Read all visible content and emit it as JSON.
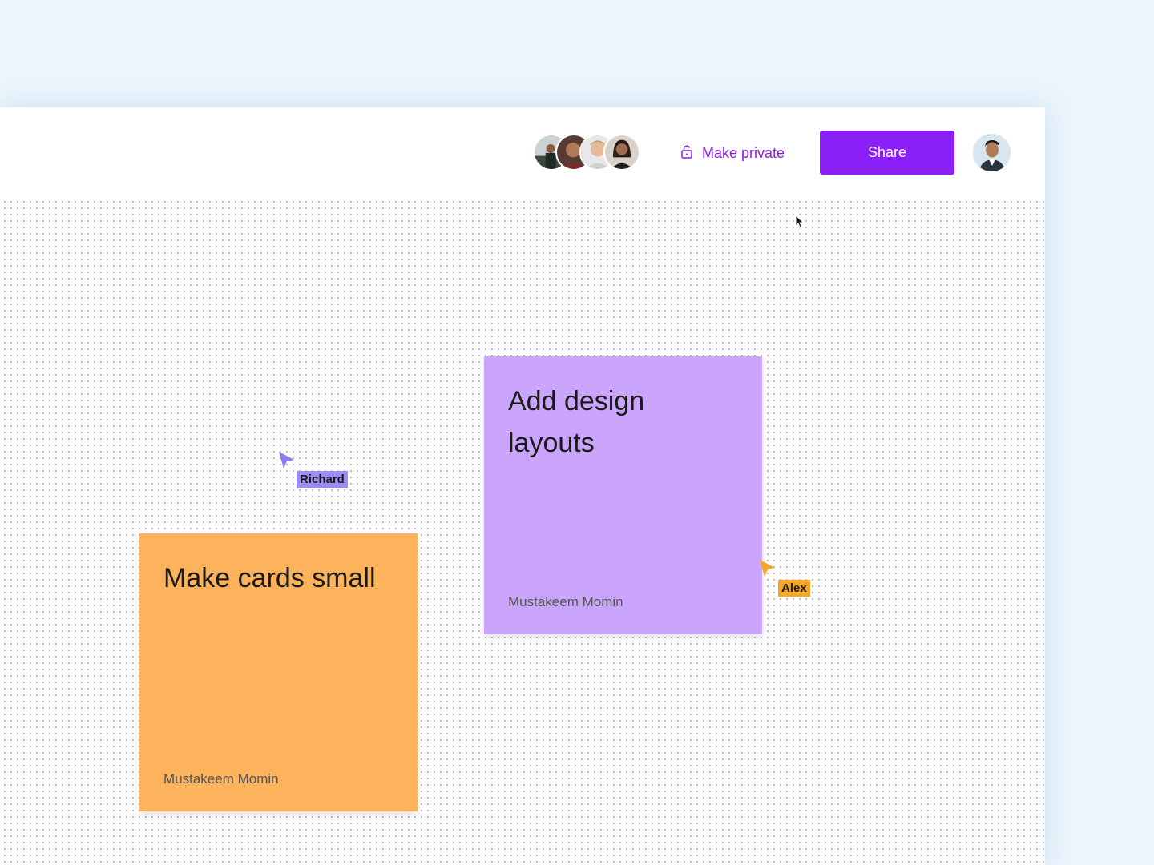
{
  "header": {
    "collaborators": [
      {
        "name": "collaborator-1",
        "color": "#3b4a3f",
        "skin": "#8a5a44"
      },
      {
        "name": "collaborator-2",
        "color": "#7a2b2b",
        "skin": "#b07a5a"
      },
      {
        "name": "collaborator-3",
        "color": "#cfcfcf",
        "skin": "#e5b99a"
      },
      {
        "name": "collaborator-4",
        "color": "#d9d2c8",
        "skin": "#9c6a4e"
      }
    ],
    "make_private_label": "Make private",
    "share_label": "Share"
  },
  "stickies": [
    {
      "title": "Add design layouts",
      "author": "Mustakeem Momin",
      "color": "#cba5fb"
    },
    {
      "title": "Make cards small",
      "author": "Mustakeem Momin",
      "color": "#fcb35b"
    }
  ],
  "cursors": [
    {
      "name": "Richard",
      "color": "#9b8cf7"
    },
    {
      "name": "Alex",
      "color": "#f5a623"
    }
  ],
  "colors": {
    "accent": "#8a1ff8",
    "background": "#ebf5fc"
  }
}
